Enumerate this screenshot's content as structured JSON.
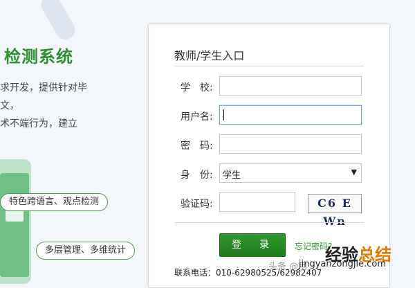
{
  "hero": {
    "title": "检测系统",
    "desc_lines": [
      "求开发，提供针对毕",
      "文，",
      "术不端行为，建立"
    ],
    "pills": [
      "特色跨语言、观点检测",
      "多层管理、多维统计"
    ]
  },
  "login": {
    "title": "教师/学生入口",
    "school_label": "学　校:",
    "school_value": "",
    "username_label": "用户名:",
    "username_value": "",
    "password_label": "密　码:",
    "password_value": "",
    "role_label": "身　份:",
    "role_value": "学生",
    "captcha_label": "验证码:",
    "captcha_value": "",
    "captcha_image_text": "C6 E Wn",
    "login_button": "登　录",
    "forgot_link": "忘记密码?",
    "contact": "联系电话：010-62980525/62982407"
  },
  "watermark": {
    "source": "头条 @用",
    "brand_main": "经验",
    "brand_accent": "总结",
    "url": "jingyanzongjie.com"
  },
  "colors": {
    "accent": "#2f8f2f",
    "button": "#238523",
    "background": "#f3f7fb"
  }
}
